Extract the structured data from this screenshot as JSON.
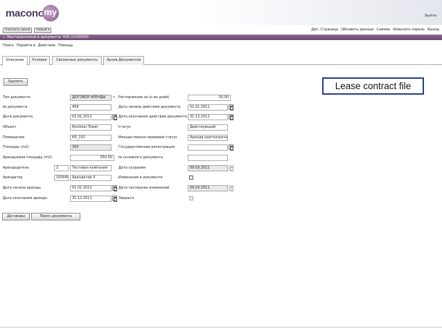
{
  "app": {
    "logo_text": "macono",
    "logo_suffix": "my",
    "exit_label": "Выйти"
  },
  "menu": {
    "show_menu": "Показать меню",
    "new": "Новый",
    "links": [
      "Доп. Страница",
      "Обновить данные",
      "Снимок",
      "Изменить пароль",
      "Выход"
    ]
  },
  "title_bar": {
    "text": "Месторасполож-е документа: 456 (2100004)"
  },
  "nav": [
    "Поиск",
    "Перейти в",
    "Действие",
    "Помощь"
  ],
  "tabs": [
    "Описание",
    "Условия",
    "Связанные документы",
    "Архив Документов"
  ],
  "buttons": {
    "delete": "Удалить",
    "contracts": "Договоры",
    "search_doc": "Поиск документа"
  },
  "callout": "Lease contract file",
  "form": {
    "left": [
      {
        "label": "Тип документа",
        "value": "ДОГОВОР АРЕНДЫ"
      },
      {
        "label": "№ документа",
        "value": "456"
      },
      {
        "label": "Дата документа",
        "value": "01.01.2011"
      },
      {
        "label": "Объект",
        "value": "Nordstar Tower"
      },
      {
        "label": "Помещения",
        "value": "NS_101"
      },
      {
        "label": "Площадь (m2)",
        "value": "350"
      },
      {
        "label": "Арендуемая площадь (m2)",
        "value": "350.00"
      },
      {
        "label": "Арендодатель",
        "code": "2",
        "value": "Тестовая компания"
      },
      {
        "label": "Арендатор",
        "code": "100049",
        "value": "Арендатор X"
      },
      {
        "label": "Дата начала аренды",
        "value": "01.01.2011"
      },
      {
        "label": "Дата окончания аренды",
        "value": "31.12.2011"
      }
    ],
    "right": [
      {
        "label": "Расторжение за (к-во дней)",
        "value": "30.00"
      },
      {
        "label": "Дата начала действия документа",
        "value": "01.01.2011"
      },
      {
        "label": "Дата окончания действия документа",
        "value": "31.12.2011"
      },
      {
        "label": "Статус",
        "value": "Действующий"
      },
      {
        "label": "Имущественно-правовой статус",
        "value": "Аренда краткосрочна"
      },
      {
        "label": "Государственная регистрация",
        "value": ""
      },
      {
        "label": "№ основного документа",
        "value": ""
      },
      {
        "label": "Дата создания",
        "value": "09.03.2011"
      },
      {
        "label": "Изменения в документе",
        "value": ""
      },
      {
        "label": "Дата последних изменений",
        "value": "09.03.2011"
      },
      {
        "label": "Закрыто",
        "value": ""
      }
    ]
  }
}
